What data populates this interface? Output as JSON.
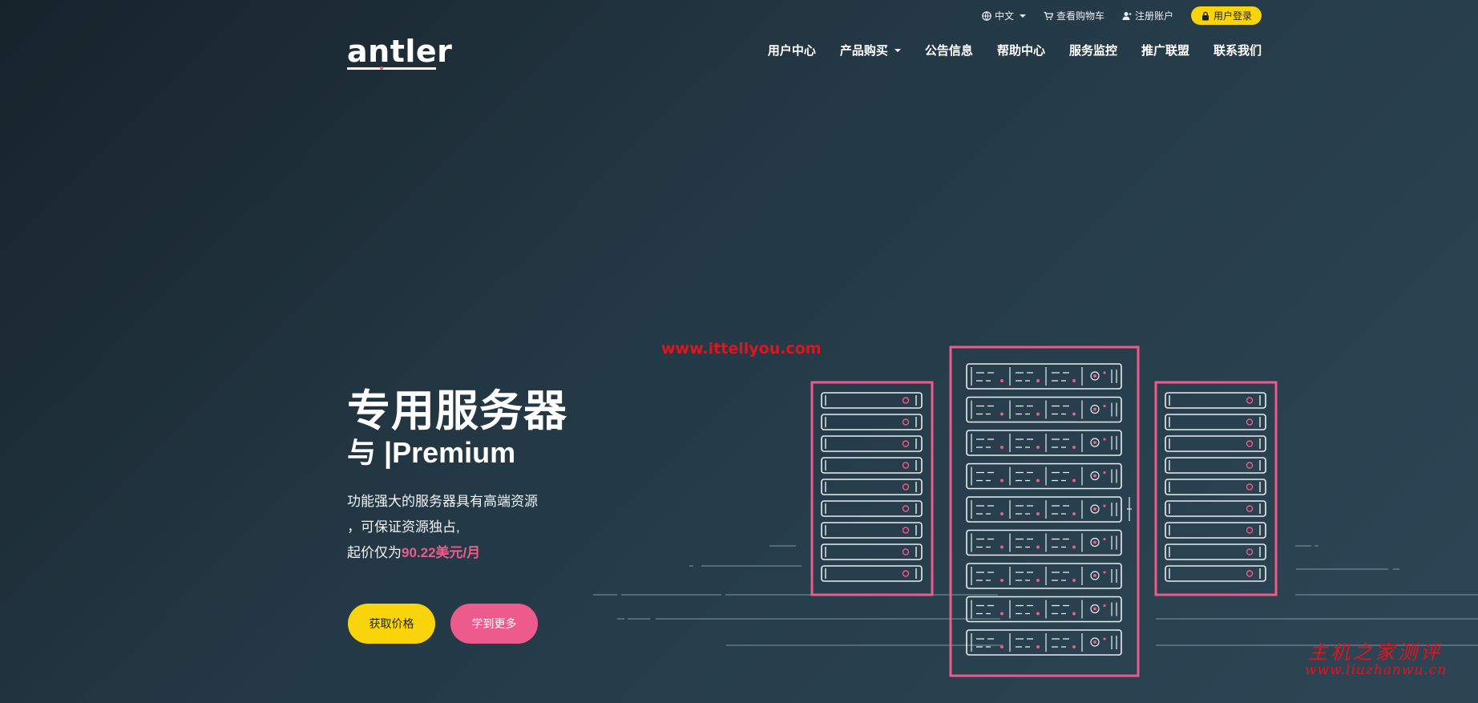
{
  "topbar": {
    "language": "中文",
    "cart": "查看购物车",
    "register": "注册账户",
    "login": "用户登录"
  },
  "logo": {
    "text": "antler"
  },
  "nav": {
    "items": [
      "用户中心",
      "产品购买",
      "公告信息",
      "帮助中心",
      "服务监控",
      "推广联盟",
      "联系我们"
    ]
  },
  "hero": {
    "title": "专用服务器",
    "subtitle": "与 |Premium",
    "desc_line1": "功能强大的服务器具有高端资源",
    "desc_line2": "，可保证资源独占,",
    "desc_line3_prefix": "起价仅为",
    "price": "90.22美元/月",
    "btn_primary": "获取价格",
    "btn_secondary": "学到更多"
  },
  "watermarks": {
    "url_top": "www.ittellyou.com",
    "cn_text": "主机之家测评",
    "cn_url": "www.liuzhanwu.cn"
  },
  "colors": {
    "accent_yellow": "#f9d40b",
    "accent_pink": "#ec5b8b",
    "bg_dark": "#17232b",
    "bg_light": "#2d4655"
  },
  "icons": {
    "language": "globe-icon",
    "cart": "cart-icon",
    "register": "user-plus-icon",
    "login": "lock-icon"
  }
}
